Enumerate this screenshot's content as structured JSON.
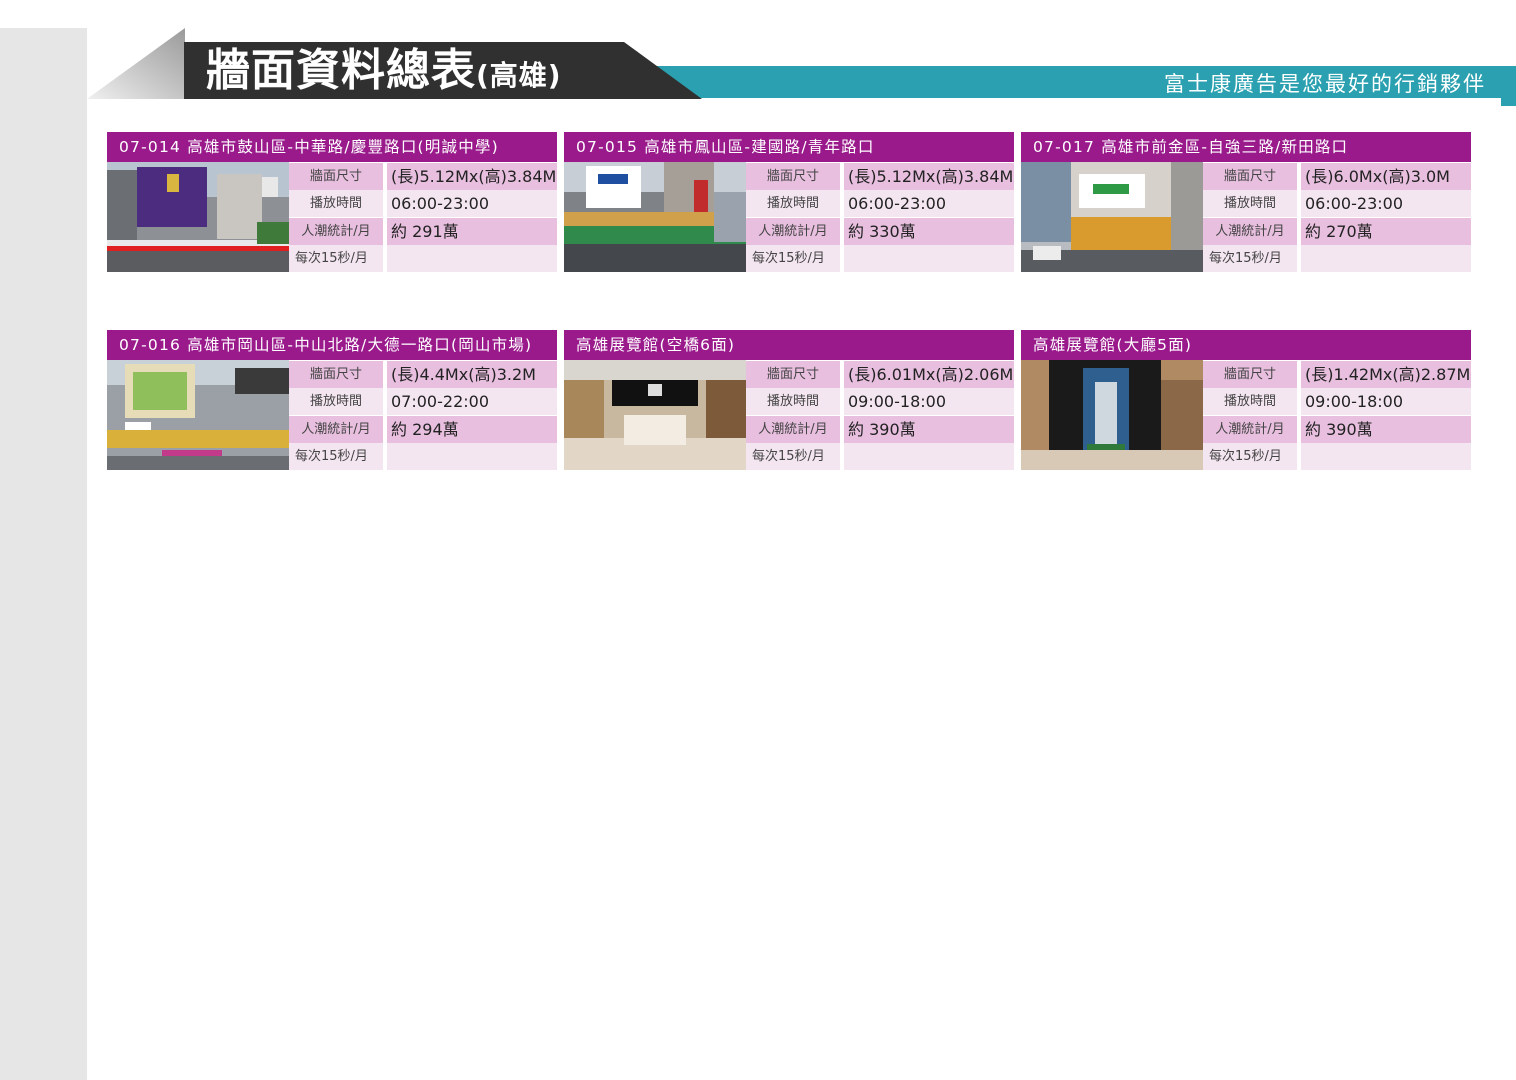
{
  "header": {
    "title_main": "牆面資料總表",
    "title_sub": "(高雄)",
    "slogan": "富士康廣告是您最好的行銷夥伴",
    "colors": {
      "dark": "#303030",
      "teal": "#2aa0b0",
      "purple": "#9a1a8c",
      "pink": "#e8bfdf",
      "light_pink": "#f4e6f1"
    }
  },
  "labels": {
    "size": "牆面尺寸",
    "hours": "播放時間",
    "traffic": "人潮統計/月",
    "frequency": "每次15秒/月"
  },
  "cards": [
    {
      "title": "07-014 高雄市鼓山區-中華路/慶豐路口(明誠中學)",
      "size": "(長)5.12Mx(高)3.84M",
      "hours": "06:00-23:00",
      "traffic": "約 291萬",
      "photo": "street-billboard-photo"
    },
    {
      "title": "07-015 高雄市鳳山區-建國路/青年路口",
      "size": "(長)5.12Mx(高)3.84M",
      "hours": "06:00-23:00",
      "traffic": "約 330萬",
      "photo": "street-billboard-photo"
    },
    {
      "title": "07-017 高雄市前金區-自強三路/新田路口",
      "size": "(長)6.0Mx(高)3.0M",
      "hours": "06:00-23:00",
      "traffic": "約 270萬",
      "photo": "building-billboard-photo"
    },
    {
      "title": "07-016 高雄市岡山區-中山北路/大德一路口(岡山市場)",
      "size": "(長)4.4Mx(高)3.2M",
      "hours": "07:00-22:00",
      "traffic": "約 294萬",
      "photo": "market-billboard-photo"
    },
    {
      "title": "高雄展覽館(空橋6面)",
      "size": "(長)6.01Mx(高)2.06M",
      "hours": "09:00-18:00",
      "traffic": "約 390萬",
      "photo": "skybridge-screen-photo"
    },
    {
      "title": "高雄展覽館(大廳5面)",
      "size": "(長)1.42Mx(高)2.87M",
      "hours": "09:00-18:00",
      "traffic": "約 390萬",
      "photo": "lobby-screen-photo"
    }
  ]
}
